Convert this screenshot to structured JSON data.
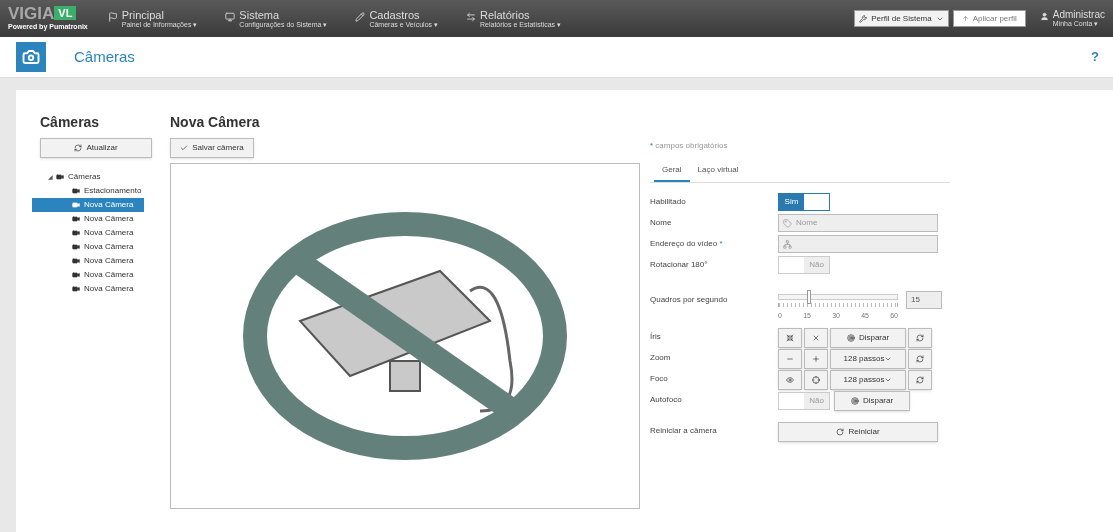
{
  "navbar": {
    "logo_left": "VIGIA",
    "logo_right": "VL",
    "powered_by": "Powered by Pumatronix",
    "menus": [
      {
        "label": "Principal",
        "sublabel": "Painel de Informações ▾"
      },
      {
        "label": "Sistema",
        "sublabel": "Configurações do Sistema ▾"
      },
      {
        "label": "Cadastros",
        "sublabel": "Câmeras e Veículos ▾"
      },
      {
        "label": "Relatórios",
        "sublabel": "Relatórios e Estatísticas ▾"
      }
    ],
    "profile_select": "Perfil de Sistema",
    "apply_button": "Aplicar perfil",
    "user": {
      "name": "Administrac",
      "sublabel": "Minha Conta ▾"
    }
  },
  "page_header": {
    "title": "Câmeras",
    "help": "?"
  },
  "sidebar": {
    "title": "Câmeras",
    "refresh_button": "Atualizar",
    "tree": [
      {
        "label": "Câmeras",
        "expander": "◢",
        "expanded": true,
        "selected": false,
        "children": [
          {
            "label": "Estacionamento",
            "selected": false
          },
          {
            "label": "Nova Câmera",
            "selected": true
          },
          {
            "label": "Nova Câmera",
            "selected": false
          },
          {
            "label": "Nova Câmera",
            "selected": false
          },
          {
            "label": "Nova Câmera",
            "selected": false
          },
          {
            "label": "Nova Câmera",
            "selected": false
          },
          {
            "label": "Nova Câmera",
            "selected": false
          },
          {
            "label": "Nova Câmera",
            "selected": false
          }
        ]
      }
    ]
  },
  "editor": {
    "title": "Nova Câmera",
    "save_button": "Salvar câmera",
    "required_mark": "*",
    "required_note": "campos obrigatórios",
    "tabs": [
      {
        "label": "Geral",
        "selected": true
      },
      {
        "label": "Laço virtual",
        "selected": false
      }
    ],
    "fields": [
      {
        "kind": "toggle",
        "label": "Habilitado",
        "on": true,
        "text": "Sim"
      },
      {
        "kind": "text",
        "label": "Nome",
        "placeholder": "Nome",
        "required": false
      },
      {
        "kind": "text",
        "label": "Endereço do vídeo",
        "required": true
      },
      {
        "kind": "toggle",
        "label": "Rotacionar 180°",
        "on": false,
        "text": "Não"
      },
      {
        "kind": "slider",
        "label": "Quadros por segundo",
        "level": 0.25,
        "value": "15",
        "ticks": [
          "0",
          "15",
          "30",
          "45",
          "60"
        ]
      },
      {
        "kind": "iris",
        "label": "Íris",
        "action": "Disparar"
      },
      {
        "kind": "steps",
        "label": "Zoom",
        "steps": "128 passos"
      },
      {
        "kind": "steps",
        "label": "Foco",
        "steps": "128 passos"
      },
      {
        "kind": "autofocus",
        "label": "Autofoco",
        "on": false,
        "text": "Não",
        "action": "Disparar"
      },
      {
        "kind": "restart",
        "label": "Reiniciar a câmera",
        "action": "Reiniciar"
      }
    ]
  }
}
